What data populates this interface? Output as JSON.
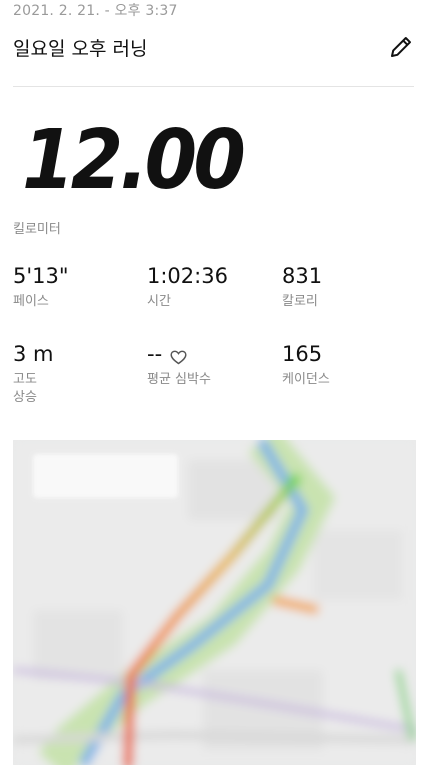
{
  "header": {
    "date": "2021. 2. 21. - 오후 3:37",
    "title": "일요일 오후 러닝",
    "edit_icon": "pencil-icon"
  },
  "summary": {
    "distance": "12.00",
    "distance_unit": "킬로미터"
  },
  "stats": {
    "pace": {
      "value": "5'13\"",
      "label": "페이스"
    },
    "time": {
      "value": "1:02:36",
      "label": "시간"
    },
    "calories": {
      "value": "831",
      "label": "칼로리"
    },
    "elevation": {
      "value": "3 m",
      "label_line1": "고도",
      "label_line2": "상승"
    },
    "heart_rate": {
      "value": "--",
      "label": "평균 심박수",
      "icon": "heart-icon"
    },
    "cadence": {
      "value": "165",
      "label": "케이던스"
    }
  },
  "map": {
    "route_colors": [
      "#e8542a",
      "#f08a2a",
      "#e7b32c",
      "#a9c935",
      "#6ed34b"
    ],
    "river_color": "#7db2e8",
    "park_color": "#bfe0a6"
  }
}
